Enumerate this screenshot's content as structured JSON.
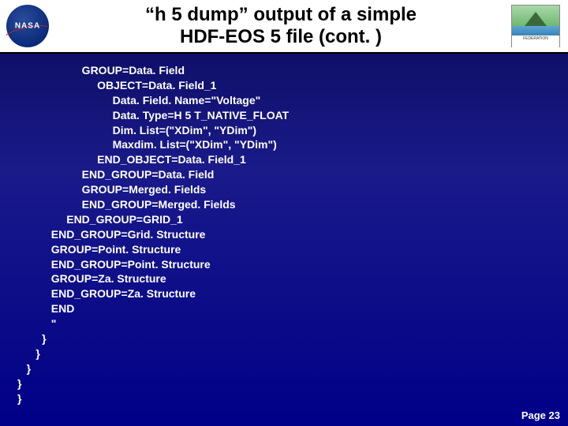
{
  "header": {
    "title_line1": "“h 5 dump” output of a simple",
    "title_line2": "HDF-EOS 5 file (cont. )",
    "nasa_label": "NASA",
    "esip_label": "FEDERATION"
  },
  "code": {
    "lines": [
      "                     GROUP=Data. Field",
      "                          OBJECT=Data. Field_1",
      "                               Data. Field. Name=\"Voltage\"",
      "                               Data. Type=H 5 T_NATIVE_FLOAT",
      "                               Dim. List=(\"XDim\", \"YDim\")",
      "                               Maxdim. List=(\"XDim\", \"YDim\")",
      "                          END_OBJECT=Data. Field_1",
      "                     END_GROUP=Data. Field",
      "                     GROUP=Merged. Fields",
      "                     END_GROUP=Merged. Fields",
      "                END_GROUP=GRID_1",
      "           END_GROUP=Grid. Structure",
      "           GROUP=Point. Structure",
      "           END_GROUP=Point. Structure",
      "           GROUP=Za. Structure",
      "           END_GROUP=Za. Structure",
      "           END",
      "           \"",
      "        }",
      "      }",
      "   }",
      "}",
      "}"
    ]
  },
  "footer": {
    "page": "Page 23"
  }
}
